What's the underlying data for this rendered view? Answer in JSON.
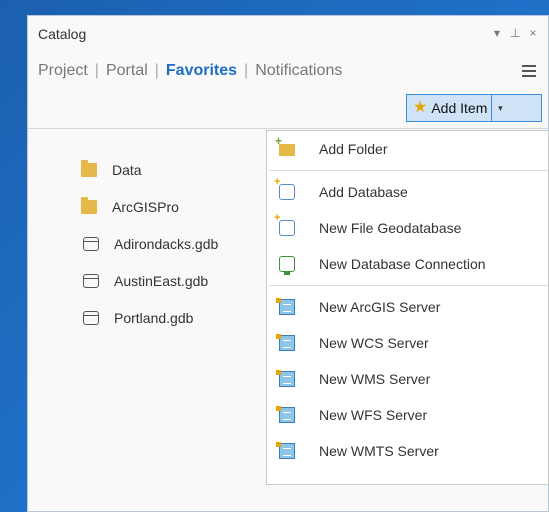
{
  "panel": {
    "title": "Catalog",
    "controls": {
      "menu": "▾",
      "pin": "⊥",
      "close": "×"
    }
  },
  "tabs": [
    {
      "label": "Project"
    },
    {
      "label": "Portal"
    },
    {
      "label": "Favorites"
    },
    {
      "label": "Notifications"
    }
  ],
  "tab_separator": "|",
  "add_item": {
    "label": "Add Item",
    "star": "★",
    "arrow": "▾"
  },
  "favorites": [
    {
      "label": "Data",
      "icon": "folder-icon"
    },
    {
      "label": "ArcGISPro",
      "icon": "folder-icon"
    },
    {
      "label": "Adirondacks.gdb",
      "icon": "geodatabase-icon"
    },
    {
      "label": "AustinEast.gdb",
      "icon": "geodatabase-icon"
    },
    {
      "label": "Portland.gdb",
      "icon": "geodatabase-icon"
    }
  ],
  "menu": {
    "items": [
      {
        "label": "Add Folder",
        "icon": "add-folder-icon"
      },
      {
        "label": "Add Database",
        "icon": "add-database-icon"
      },
      {
        "label": "New File Geodatabase",
        "icon": "new-geodatabase-icon"
      },
      {
        "label": "New Database Connection",
        "icon": "database-connection-icon"
      },
      {
        "label": "New ArcGIS Server",
        "icon": "server-icon"
      },
      {
        "label": "New WCS Server",
        "icon": "server-icon"
      },
      {
        "label": "New WMS Server",
        "icon": "server-icon"
      },
      {
        "label": "New WFS Server",
        "icon": "server-icon"
      },
      {
        "label": "New WMTS Server",
        "icon": "server-icon"
      }
    ]
  },
  "colors": {
    "accent": "#1f6ec4",
    "folder": "#e6b84a",
    "background": "#1e6fc6"
  }
}
